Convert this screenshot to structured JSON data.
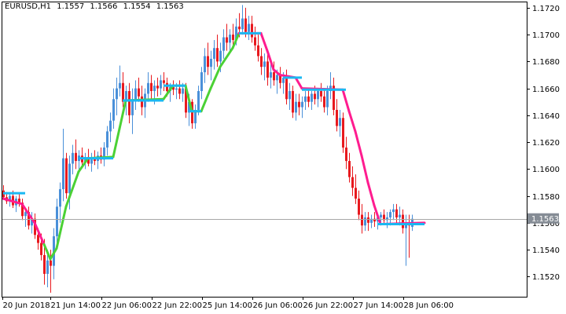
{
  "header": {
    "symbol": "EURUSD,H1",
    "open": "1.1557",
    "high": "1.1566",
    "low": "1.1554",
    "close": "1.1563"
  },
  "current_price_label": "1.1563",
  "colors": {
    "background": "#ffffff",
    "axis": "#000000",
    "bull_candle": "#4a90d9",
    "bear_candle": "#e8191e",
    "line_up": "#4bd135",
    "line_down": "#ff1c8f",
    "step_line": "#1ab8f2",
    "price_line": "#a7a7a7",
    "price_tag": "#858c95"
  },
  "chart_data": {
    "type": "candlestick",
    "title": "EURUSD,H1",
    "y_ticks": [
      "1.1720",
      "1.1700",
      "1.1680",
      "1.1660",
      "1.1640",
      "1.1620",
      "1.1600",
      "1.1580",
      "1.1560",
      "1.1540",
      "1.1520"
    ],
    "ylim": [
      1.1505,
      1.1724
    ],
    "x_ticks": [
      "20 Jun 2018",
      "21 Jun 14:00",
      "22 Jun 06:00",
      "22 Jun 22:00",
      "25 Jun 14:00",
      "26 Jun 06:00",
      "26 Jun 22:00",
      "27 Jun 14:00",
      "28 Jun 06:00"
    ],
    "current_price": 1.1563,
    "trend_line": [
      {
        "bar": 0,
        "v": 1.1578,
        "dir": "down"
      },
      {
        "bar": 6,
        "v": 1.1574,
        "dir": "down"
      },
      {
        "bar": 10,
        "v": 1.156,
        "dir": "down"
      },
      {
        "bar": 13,
        "v": 1.1544,
        "dir": "down"
      },
      {
        "bar": 15,
        "v": 1.1533,
        "dir": "up"
      },
      {
        "bar": 17,
        "v": 1.1541,
        "dir": "up"
      },
      {
        "bar": 20,
        "v": 1.1572,
        "dir": "up"
      },
      {
        "bar": 24,
        "v": 1.1598,
        "dir": "up"
      },
      {
        "bar": 27,
        "v": 1.1608,
        "dir": "up"
      },
      {
        "bar": 35,
        "v": 1.1609,
        "dir": "up"
      },
      {
        "bar": 37,
        "v": 1.163,
        "dir": "up"
      },
      {
        "bar": 39,
        "v": 1.1651,
        "dir": "up"
      },
      {
        "bar": 51,
        "v": 1.1652,
        "dir": "up"
      },
      {
        "bar": 54,
        "v": 1.1662,
        "dir": "up"
      },
      {
        "bar": 58,
        "v": 1.1662,
        "dir": "up"
      },
      {
        "bar": 60,
        "v": 1.1643,
        "dir": "up"
      },
      {
        "bar": 63,
        "v": 1.1643,
        "dir": "up"
      },
      {
        "bar": 66,
        "v": 1.166,
        "dir": "up"
      },
      {
        "bar": 69,
        "v": 1.1676,
        "dir": "up"
      },
      {
        "bar": 73,
        "v": 1.169,
        "dir": "up"
      },
      {
        "bar": 75,
        "v": 1.1701,
        "dir": "up"
      },
      {
        "bar": 82,
        "v": 1.1701,
        "dir": "down"
      },
      {
        "bar": 84,
        "v": 1.1688,
        "dir": "down"
      },
      {
        "bar": 86,
        "v": 1.1674,
        "dir": "down"
      },
      {
        "bar": 88,
        "v": 1.167,
        "dir": "down"
      },
      {
        "bar": 93,
        "v": 1.1668,
        "dir": "down"
      },
      {
        "bar": 95,
        "v": 1.166,
        "dir": "down"
      },
      {
        "bar": 108,
        "v": 1.1659,
        "dir": "down"
      },
      {
        "bar": 110,
        "v": 1.1643,
        "dir": "down"
      },
      {
        "bar": 112,
        "v": 1.1628,
        "dir": "down"
      },
      {
        "bar": 114,
        "v": 1.161,
        "dir": "down"
      },
      {
        "bar": 116,
        "v": 1.159,
        "dir": "down"
      },
      {
        "bar": 118,
        "v": 1.1573,
        "dir": "down"
      },
      {
        "bar": 120,
        "v": 1.1559,
        "dir": "down"
      },
      {
        "bar": 134,
        "v": 1.156,
        "dir": "down"
      }
    ],
    "step_line": [
      {
        "from": 0,
        "to": 7,
        "v": 1.1582
      },
      {
        "from": 24,
        "to": 35,
        "v": 1.1608
      },
      {
        "from": 38,
        "to": 51,
        "v": 1.1651
      },
      {
        "from": 51,
        "to": 58,
        "v": 1.1662
      },
      {
        "from": 59,
        "to": 63,
        "v": 1.1643
      },
      {
        "from": 75,
        "to": 82,
        "v": 1.1701
      },
      {
        "from": 89,
        "to": 95,
        "v": 1.1668
      },
      {
        "from": 95,
        "to": 109,
        "v": 1.1659
      },
      {
        "from": 119,
        "to": 134,
        "v": 1.1559
      }
    ],
    "candles": [
      [
        1.1584,
        1.1588,
        1.1577,
        1.1579
      ],
      [
        1.1579,
        1.1583,
        1.1574,
        1.1576
      ],
      [
        1.1576,
        1.1582,
        1.1572,
        1.158
      ],
      [
        1.158,
        1.1584,
        1.1571,
        1.1573
      ],
      [
        1.1573,
        1.158,
        1.1568,
        1.1578
      ],
      [
        1.1578,
        1.1582,
        1.1572,
        1.1575
      ],
      [
        1.1575,
        1.1578,
        1.1562,
        1.1565
      ],
      [
        1.1565,
        1.1571,
        1.1557,
        1.1568
      ],
      [
        1.1568,
        1.1572,
        1.1555,
        1.1558
      ],
      [
        1.1558,
        1.1568,
        1.1552,
        1.1563
      ],
      [
        1.1563,
        1.1567,
        1.1548,
        1.1551
      ],
      [
        1.1551,
        1.1556,
        1.154,
        1.1545
      ],
      [
        1.1545,
        1.1552,
        1.1532,
        1.1536
      ],
      [
        1.1536,
        1.1548,
        1.1514,
        1.1522
      ],
      [
        1.1522,
        1.154,
        1.1512,
        1.1532
      ],
      [
        1.1532,
        1.154,
        1.1508,
        1.1528
      ],
      [
        1.1528,
        1.1556,
        1.1518,
        1.155
      ],
      [
        1.155,
        1.1578,
        1.1545,
        1.1572
      ],
      [
        1.1572,
        1.159,
        1.156,
        1.1585
      ],
      [
        1.1585,
        1.163,
        1.1576,
        1.1608
      ],
      [
        1.1608,
        1.1612,
        1.1578,
        1.1582
      ],
      [
        1.1582,
        1.161,
        1.157,
        1.1604
      ],
      [
        1.1604,
        1.1618,
        1.1596,
        1.1612
      ],
      [
        1.1612,
        1.1622,
        1.16,
        1.1606
      ],
      [
        1.1606,
        1.1614,
        1.1598,
        1.161
      ],
      [
        1.161,
        1.1616,
        1.1603,
        1.1605
      ],
      [
        1.1605,
        1.1612,
        1.16,
        1.1609
      ],
      [
        1.1609,
        1.1615,
        1.1602,
        1.1604
      ],
      [
        1.1604,
        1.1612,
        1.1598,
        1.1608
      ],
      [
        1.1608,
        1.1614,
        1.1603,
        1.1606
      ],
      [
        1.1606,
        1.1613,
        1.16,
        1.161
      ],
      [
        1.161,
        1.1616,
        1.1604,
        1.1607
      ],
      [
        1.1607,
        1.162,
        1.1602,
        1.1616
      ],
      [
        1.1616,
        1.1632,
        1.161,
        1.1628
      ],
      [
        1.1628,
        1.1642,
        1.162,
        1.1636
      ],
      [
        1.1636,
        1.166,
        1.163,
        1.1652
      ],
      [
        1.1652,
        1.1668,
        1.164,
        1.166
      ],
      [
        1.166,
        1.1677,
        1.1654,
        1.1664
      ],
      [
        1.1664,
        1.1672,
        1.1646,
        1.165
      ],
      [
        1.165,
        1.1662,
        1.164,
        1.1658
      ],
      [
        1.1658,
        1.1664,
        1.1634,
        1.164
      ],
      [
        1.164,
        1.166,
        1.1626,
        1.1652
      ],
      [
        1.1652,
        1.1666,
        1.1644,
        1.166
      ],
      [
        1.166,
        1.1668,
        1.165,
        1.1654
      ],
      [
        1.1654,
        1.1662,
        1.164,
        1.1646
      ],
      [
        1.1646,
        1.166,
        1.1638,
        1.1656
      ],
      [
        1.1656,
        1.1672,
        1.165,
        1.1664
      ],
      [
        1.1664,
        1.167,
        1.1652,
        1.1658
      ],
      [
        1.1658,
        1.1666,
        1.1648,
        1.1662
      ],
      [
        1.1662,
        1.1668,
        1.1654,
        1.166
      ],
      [
        1.166,
        1.167,
        1.1655,
        1.1666
      ],
      [
        1.1666,
        1.1672,
        1.1658,
        1.1664
      ],
      [
        1.1664,
        1.1668,
        1.1654,
        1.1658
      ],
      [
        1.1658,
        1.1664,
        1.165,
        1.1661
      ],
      [
        1.1661,
        1.1666,
        1.1655,
        1.1659
      ],
      [
        1.1659,
        1.1664,
        1.1652,
        1.166
      ],
      [
        1.166,
        1.1666,
        1.1652,
        1.1656
      ],
      [
        1.1656,
        1.1664,
        1.165,
        1.166
      ],
      [
        1.166,
        1.1664,
        1.1638,
        1.1642
      ],
      [
        1.1642,
        1.1656,
        1.1632,
        1.165
      ],
      [
        1.165,
        1.1652,
        1.163,
        1.1634
      ],
      [
        1.1634,
        1.1648,
        1.163,
        1.1644
      ],
      [
        1.1644,
        1.1662,
        1.164,
        1.1658
      ],
      [
        1.1658,
        1.1676,
        1.1652,
        1.1672
      ],
      [
        1.1672,
        1.169,
        1.1664,
        1.1684
      ],
      [
        1.1684,
        1.1694,
        1.167,
        1.1676
      ],
      [
        1.1676,
        1.1688,
        1.1666,
        1.1682
      ],
      [
        1.1682,
        1.1696,
        1.1674,
        1.169
      ],
      [
        1.169,
        1.17,
        1.1676,
        1.168
      ],
      [
        1.168,
        1.1694,
        1.1672,
        1.1688
      ],
      [
        1.1688,
        1.1704,
        1.1682,
        1.1698
      ],
      [
        1.1698,
        1.1708,
        1.1688,
        1.1694
      ],
      [
        1.1694,
        1.1704,
        1.1686,
        1.17
      ],
      [
        1.17,
        1.1708,
        1.169,
        1.1696
      ],
      [
        1.1696,
        1.1712,
        1.1692,
        1.1706
      ],
      [
        1.1706,
        1.1716,
        1.1698,
        1.1704
      ],
      [
        1.1704,
        1.1722,
        1.17,
        1.1712
      ],
      [
        1.1712,
        1.172,
        1.1698,
        1.1702
      ],
      [
        1.1702,
        1.1714,
        1.1696,
        1.1708
      ],
      [
        1.1708,
        1.1714,
        1.1694,
        1.1698
      ],
      [
        1.1698,
        1.1706,
        1.1688,
        1.1692
      ],
      [
        1.1692,
        1.17,
        1.168,
        1.1684
      ],
      [
        1.1684,
        1.169,
        1.167,
        1.1676
      ],
      [
        1.1676,
        1.1686,
        1.1666,
        1.168
      ],
      [
        1.168,
        1.1686,
        1.1662,
        1.1668
      ],
      [
        1.1668,
        1.1678,
        1.166,
        1.1672
      ],
      [
        1.1672,
        1.168,
        1.1662,
        1.1666
      ],
      [
        1.1666,
        1.1674,
        1.1656,
        1.167
      ],
      [
        1.167,
        1.1676,
        1.166,
        1.1664
      ],
      [
        1.1664,
        1.1672,
        1.1656,
        1.1668
      ],
      [
        1.1668,
        1.1674,
        1.1648,
        1.1652
      ],
      [
        1.1652,
        1.1664,
        1.1644,
        1.1658
      ],
      [
        1.1658,
        1.1662,
        1.1638,
        1.1642
      ],
      [
        1.1642,
        1.1656,
        1.1636,
        1.165
      ],
      [
        1.165,
        1.1656,
        1.164,
        1.1646
      ],
      [
        1.1646,
        1.1654,
        1.1638,
        1.165
      ],
      [
        1.165,
        1.1658,
        1.1644,
        1.1654
      ],
      [
        1.1654,
        1.166,
        1.1646,
        1.165
      ],
      [
        1.165,
        1.1658,
        1.1644,
        1.1656
      ],
      [
        1.1656,
        1.1662,
        1.1648,
        1.1652
      ],
      [
        1.1652,
        1.166,
        1.1646,
        1.1658
      ],
      [
        1.1658,
        1.1664,
        1.165,
        1.1654
      ],
      [
        1.1654,
        1.166,
        1.1642,
        1.1646
      ],
      [
        1.1646,
        1.1662,
        1.164,
        1.1658
      ],
      [
        1.1658,
        1.1672,
        1.1652,
        1.1662
      ],
      [
        1.1662,
        1.1668,
        1.164,
        1.1644
      ],
      [
        1.1644,
        1.1652,
        1.1628,
        1.1632
      ],
      [
        1.1632,
        1.1644,
        1.1624,
        1.1638
      ],
      [
        1.1638,
        1.1642,
        1.1612,
        1.1616
      ],
      [
        1.1616,
        1.1624,
        1.16,
        1.1606
      ],
      [
        1.1606,
        1.1612,
        1.159,
        1.1594
      ],
      [
        1.1594,
        1.1602,
        1.158,
        1.1586
      ],
      [
        1.1586,
        1.1596,
        1.1574,
        1.1578
      ],
      [
        1.1578,
        1.1584,
        1.1562,
        1.1566
      ],
      [
        1.1566,
        1.1574,
        1.1552,
        1.1558
      ],
      [
        1.1558,
        1.1568,
        1.1554,
        1.1564
      ],
      [
        1.1564,
        1.1568,
        1.1554,
        1.156
      ],
      [
        1.156,
        1.1566,
        1.1556,
        1.1563
      ],
      [
        1.1563,
        1.1568,
        1.1557,
        1.1561
      ],
      [
        1.1561,
        1.1566,
        1.1555,
        1.1564
      ],
      [
        1.1564,
        1.1568,
        1.1558,
        1.1566
      ],
      [
        1.1566,
        1.157,
        1.156,
        1.1562
      ],
      [
        1.1562,
        1.1568,
        1.1556,
        1.1564
      ],
      [
        1.1564,
        1.157,
        1.1558,
        1.1568
      ],
      [
        1.1568,
        1.1574,
        1.1562,
        1.157
      ],
      [
        1.157,
        1.1574,
        1.156,
        1.1564
      ],
      [
        1.1564,
        1.1572,
        1.1558,
        1.1566
      ],
      [
        1.1566,
        1.157,
        1.1552,
        1.1556
      ],
      [
        1.1556,
        1.1566,
        1.1528,
        1.156
      ],
      [
        1.156,
        1.1566,
        1.1534,
        1.1558
      ],
      [
        1.1557,
        1.1566,
        1.1554,
        1.1563
      ]
    ]
  }
}
